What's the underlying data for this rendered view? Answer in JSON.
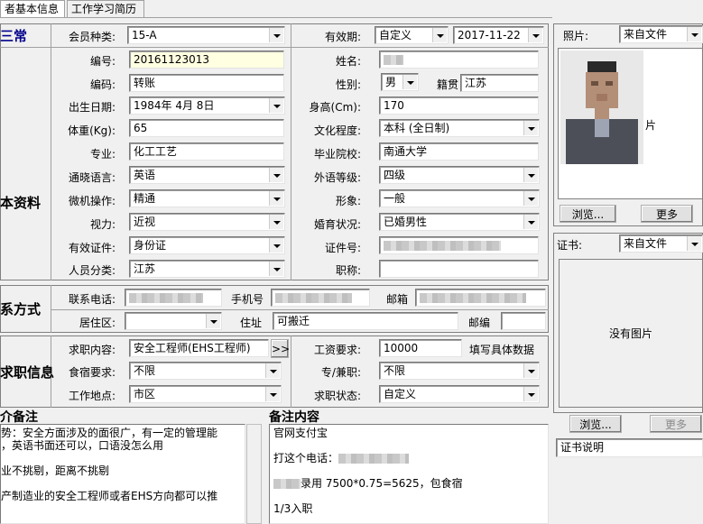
{
  "tabs": [
    {
      "label": "者基本信息"
    },
    {
      "label": "工作学习简历"
    }
  ],
  "sections": {
    "top": "三常",
    "basic": "本资料",
    "contact": "系方式",
    "job": "求职信息",
    "intro": "介备注",
    "remarks": "备注内容"
  },
  "basic": {
    "member_type_label": "会员种类:",
    "member_type_value": "15-A",
    "validity_label": "有效期:",
    "validity_mode": "自定义",
    "validity_date": "2017-11-22",
    "number_label": "编号:",
    "number_value": "20161123013",
    "name_label": "姓名:",
    "code_label": "编码:",
    "code_value": "转账",
    "gender_label": "性别:",
    "gender_value": "男",
    "origin_label": "籍贯",
    "origin_value": "江苏",
    "birth_label": "出生日期:",
    "birth_value": "1984年 4月 8日",
    "height_label": "身高(Cm):",
    "height_value": "170",
    "weight_label": "体重(Kg):",
    "weight_value": "65",
    "education_label": "文化程度:",
    "education_value": "本科 (全日制)",
    "major_label": "专业:",
    "major_value": "化工工艺",
    "school_label": "毕业院校:",
    "school_value": "南通大学",
    "language_label": "通晓语言:",
    "language_value": "英语",
    "foreign_level_label": "外语等级:",
    "foreign_level_value": "四级",
    "computer_label": "微机操作:",
    "computer_value": "精通",
    "image_label": "形象:",
    "image_value": "一般",
    "vision_label": "视力:",
    "vision_value": "近视",
    "marital_label": "婚育状况:",
    "marital_value": "已婚男性",
    "id_type_label": "有效证件:",
    "id_type_value": "身份证",
    "id_no_label": "证件号:",
    "category_label": "人员分类:",
    "category_value": "江苏",
    "title_label": "职称:"
  },
  "contact": {
    "phone_label": "联系电话:",
    "mobile_label": "手机号",
    "email_label": "邮箱",
    "district_label": "居住区:",
    "address_label": "住址",
    "address_value": "可搬迁",
    "postcode_label": "邮编"
  },
  "job": {
    "position_label": "求职内容:",
    "position_value": "安全工程师(EHS工程师)",
    "more_button": ">>",
    "salary_label": "工资要求:",
    "salary_value": "10000",
    "salary_hint": "填写具体数据",
    "board_label": "食宿要求:",
    "board_value": "不限",
    "parttime_label": "专/兼职:",
    "parttime_value": "不限",
    "location_label": "工作地点:",
    "location_value": "市区",
    "status_label": "求职状态:",
    "status_value": "自定义"
  },
  "intro_lines": [
    "势：安全方面涉及的面很广，有一定的管理能",
    "，英语书面还可以，口语没怎么用",
    "",
    "业不挑剔，距离不挑剔",
    "",
    "产制造业的安全工程师或者EHS方向都可以推"
  ],
  "remarks_lines": [
    "官网支付宝",
    "",
    "打这个电话：",
    "",
    "录用 7500*0.75=5625，包食宿",
    "",
    "1/3入职"
  ],
  "photo": {
    "label": "照片:",
    "source": "来自文件",
    "overflow_text": "片",
    "browse_button": "浏览...",
    "more_button": "更多"
  },
  "certificate": {
    "label": "证书:",
    "source": "来自文件",
    "no_image": "没有图片",
    "browse_button": "浏览...",
    "more_button": "更多",
    "description_value": "证书说明"
  }
}
